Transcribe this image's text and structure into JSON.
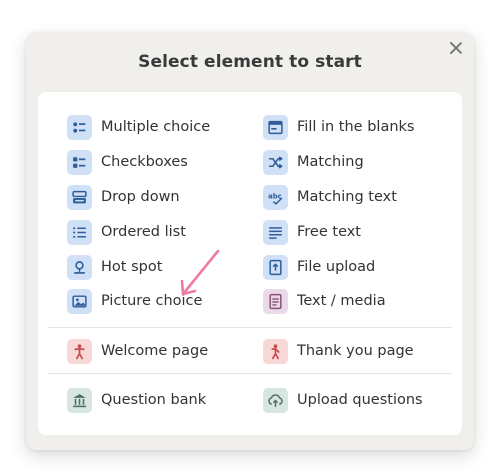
{
  "dialog": {
    "title": "Select element to start"
  },
  "elements_left": [
    {
      "label": "Multiple choice",
      "icon": "multiple-choice-icon"
    },
    {
      "label": "Checkboxes",
      "icon": "checkboxes-icon"
    },
    {
      "label": "Drop down",
      "icon": "drop-down-icon"
    },
    {
      "label": "Ordered list",
      "icon": "ordered-list-icon"
    },
    {
      "label": "Hot spot",
      "icon": "hot-spot-icon"
    },
    {
      "label": "Picture choice",
      "icon": "picture-choice-icon"
    }
  ],
  "elements_right": [
    {
      "label": "Fill in the blanks",
      "icon": "fill-in-the-blanks-icon"
    },
    {
      "label": "Matching",
      "icon": "matching-icon"
    },
    {
      "label": "Matching text",
      "icon": "matching-text-icon"
    },
    {
      "label": "Free text",
      "icon": "free-text-icon"
    },
    {
      "label": "File upload",
      "icon": "file-upload-icon"
    },
    {
      "label": "Text / media",
      "icon": "text-media-icon"
    }
  ],
  "pages": {
    "welcome": {
      "label": "Welcome page",
      "icon": "person-icon"
    },
    "thank_you": {
      "label": "Thank you page",
      "icon": "person-icon"
    }
  },
  "bank": {
    "question_bank": {
      "label": "Question bank",
      "icon": "bank-icon"
    },
    "upload_questions": {
      "label": "Upload questions",
      "icon": "cloud-upload-icon"
    }
  },
  "colors": {
    "icon_bg_blue": "#cfe0f7",
    "icon_bg_pink": "#f8d7d7",
    "icon_bg_mauve": "#ead9e6",
    "icon_bg_green": "#d7e6e0",
    "icon_fg_blue": "#2f5d9a",
    "icon_fg_red": "#c94a4a",
    "icon_fg_mauve": "#8a5378",
    "icon_fg_green": "#4f6e63",
    "annotation_arrow": "#f07aa6"
  }
}
